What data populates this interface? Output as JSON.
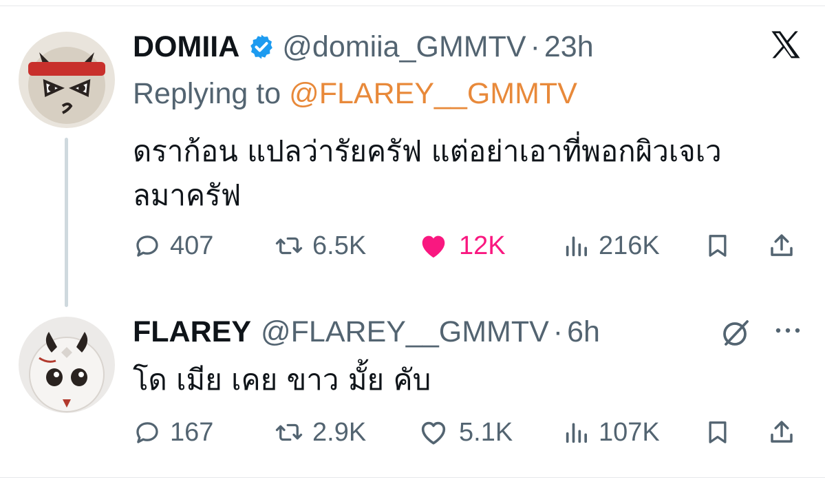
{
  "tweets": [
    {
      "name": "DOMIIA",
      "handle": "@domiia_GMMTV",
      "separator": "·",
      "time": "23h",
      "replying_label": "Replying to",
      "replying_to": "@FLAREY__GMMTV",
      "text": "ดราก้อน แปลว่ารัยครัฟ แต่อย่าเอาที่พอกผิวเจเวลมาครัฟ",
      "replies": "407",
      "retweets": "6.5K",
      "likes": "12K",
      "views": "216K",
      "liked": true
    },
    {
      "name": "FLAREY",
      "handle": "@FLAREY__GMMTV",
      "separator": "·",
      "time": "6h",
      "text": "โด เมีย เคย ขาว มั้ย คับ",
      "replies": "167",
      "retweets": "2.9K",
      "likes": "5.1K",
      "views": "107K",
      "liked": false
    }
  ],
  "icons": {
    "reply": "reply-icon",
    "retweet": "retweet-icon",
    "like": "heart-icon",
    "views": "views-icon",
    "bookmark": "bookmark-icon",
    "share": "share-icon",
    "brand": "x-logo-icon",
    "grok": "grok-icon",
    "more": "more-icon",
    "verified": "verified-badge-icon"
  },
  "colors": {
    "text": "#0f1419",
    "muted": "#536471",
    "mention": "#e8893a",
    "like": "#f91880",
    "verified": "#1d9bf0"
  }
}
